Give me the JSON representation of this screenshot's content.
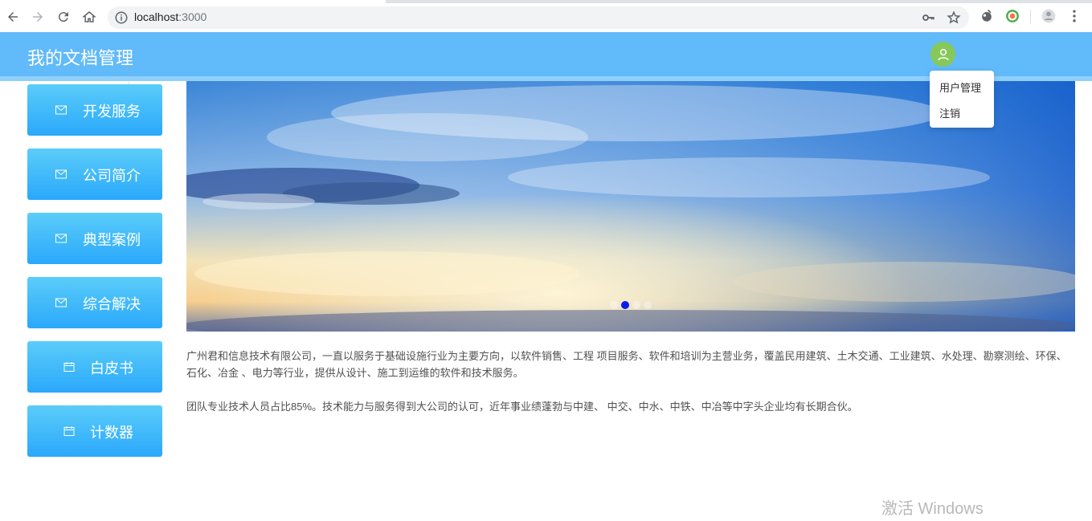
{
  "browser": {
    "url_host": "localhost",
    "url_port": ":3000"
  },
  "header": {
    "title": "我的文档管理"
  },
  "user_menu": {
    "items": [
      {
        "label": "用户管理"
      },
      {
        "label": "注销"
      }
    ]
  },
  "sidebar": {
    "items": [
      {
        "label": "开发服务",
        "icon": "mail-icon"
      },
      {
        "label": "公司简介",
        "icon": "mail-icon"
      },
      {
        "label": "典型案例",
        "icon": "mail-icon"
      },
      {
        "label": "综合解决",
        "icon": "mail-icon"
      },
      {
        "label": "白皮书",
        "icon": "calendar-icon"
      },
      {
        "label": "计数器",
        "icon": "calendar-icon"
      }
    ]
  },
  "carousel": {
    "slide_count": 4,
    "active_index": 1
  },
  "content": {
    "paragraph1": "广州君和信息技术有限公司，一直以服务于基础设施行业为主要方向，以软件销售、工程 项目服务、软件和培训为主营业务，覆盖民用建筑、土木交通、工业建筑、水处理、勘察测绘、环保、石化、冶金 、电力等行业，提供从设计、施工到运维的软件和技术服务。",
    "paragraph2": "团队专业技术人员占比85%。技术能力与服务得到大公司的认可，近年事业绩蓬勃与中建、 中交、中水、中铁、中冶等中字头企业均有长期合伙。"
  },
  "watermark": {
    "title": "激活 Windows"
  },
  "colors": {
    "header": "#61baf9",
    "sidebar_top": "#5bcdf9",
    "sidebar_bottom": "#2aa8fb",
    "avatar": "#86c95a",
    "active_dot": "#0a1ee8"
  }
}
